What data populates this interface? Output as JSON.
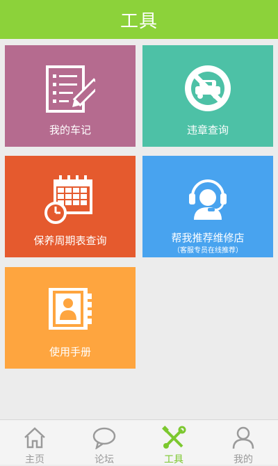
{
  "header": {
    "title": "工具"
  },
  "tiles": [
    {
      "label": "我的车记"
    },
    {
      "label": "违章查询"
    },
    {
      "label": "保养周期表查询"
    },
    {
      "label": "帮我推荐维修店",
      "sub": "（客服专员在线推荐）"
    },
    {
      "label": "使用手册"
    }
  ],
  "tabbar": {
    "items": [
      {
        "label": "主页",
        "icon": "home-icon"
      },
      {
        "label": "论坛",
        "icon": "chat-bubble-icon"
      },
      {
        "label": "工具",
        "icon": "tools-icon",
        "active": true
      },
      {
        "label": "我的",
        "icon": "user-icon"
      }
    ]
  },
  "colors": {
    "header": "#8cd23a",
    "car_log": "#b56b8f",
    "violation": "#4dc1a6",
    "maintenance": "#e55a2e",
    "repair_shop": "#48a3ef",
    "manual": "#fea53f",
    "tab_active": "#7cc82f",
    "tab_inactive": "#9a9a9a"
  }
}
